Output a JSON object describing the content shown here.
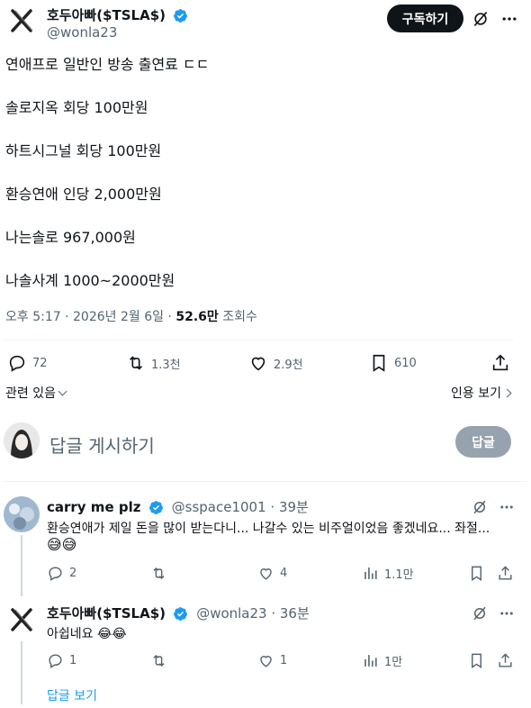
{
  "tweet": {
    "author_name": "호두아빠($TSLA$)",
    "author_handle": "@wonla23",
    "subscribe_label": "구독하기",
    "lines": [
      "연애프로 일반인 방송 출연료 ㄷㄷ",
      "솔로지옥 회당 100만원",
      "하트시그널 회당 100만원",
      "환승연애 인당 2,000만원",
      "나는솔로 967,000원",
      "나솔사계 1000~2000만원"
    ],
    "time": "오후 5:17 · 2026년 2월 6일 · ",
    "views_count": "52.6만",
    "views_label": " 조회수",
    "replies": "72",
    "retweets": "1.3천",
    "likes": "2.9천",
    "bookmarks": "610",
    "related_label": "관련 있음",
    "quotes_label": "인용 보기"
  },
  "composer": {
    "placeholder": "답글 게시하기",
    "reply_button": "답글"
  },
  "replies": [
    {
      "author_name": "carry me plz",
      "author_handle": "@sspace1001 · 39분",
      "text": "환승연애가 제일 돈을 많이 받는다니... 나갈수 있는 비주얼이었음 좋겠네요... 좌절...",
      "emoji": "😅😅",
      "replies": "2",
      "retweets": "",
      "likes": "4",
      "views": "1.1만"
    },
    {
      "author_name": "호두아빠($TSLA$)",
      "author_handle": "@wonla23 · 36분",
      "text": "아쉽네요 😂😂",
      "replies": "1",
      "retweets": "",
      "likes": "1",
      "views": "1만"
    }
  ],
  "show_replies_label": "답글 보기",
  "colors": {
    "accent": "#1d9bf0",
    "text": "#0f1419",
    "secondary": "#536471"
  }
}
